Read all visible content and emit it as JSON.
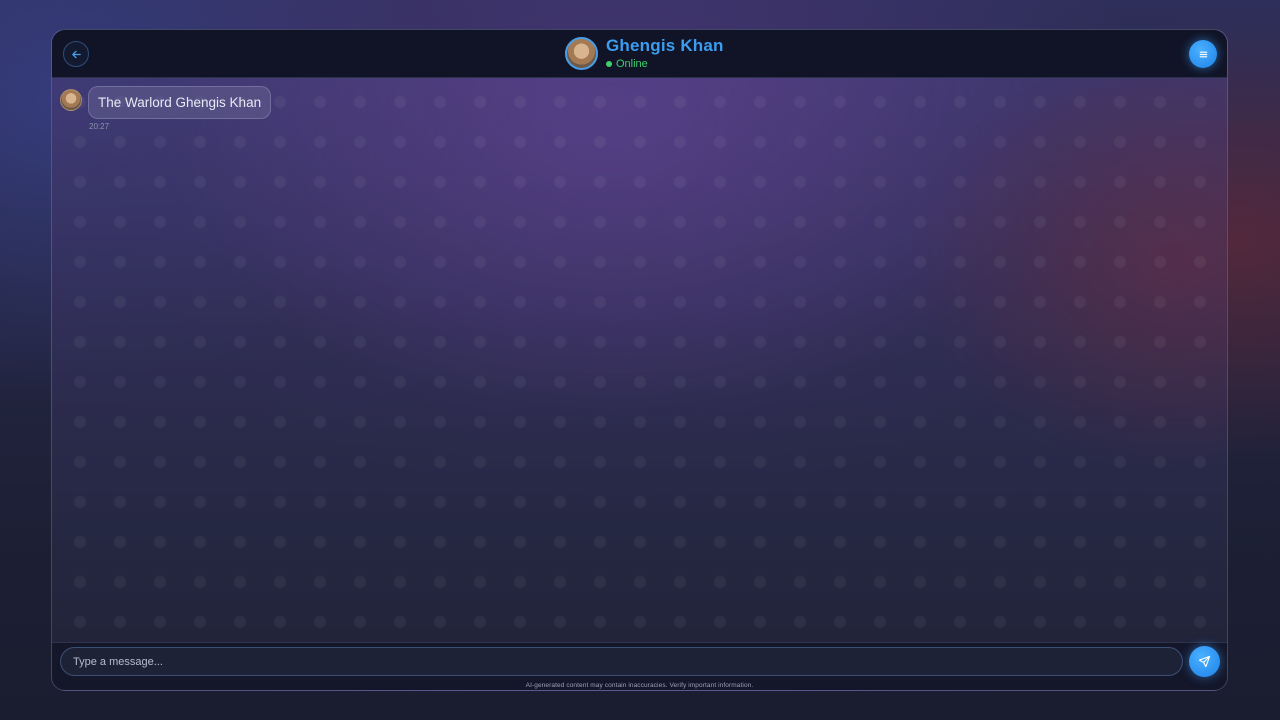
{
  "header": {
    "back_icon": "arrow-left-icon",
    "contact_name": "Ghengis Khan",
    "status": "Online",
    "menu_icon": "menu-icon"
  },
  "messages": [
    {
      "sender": "bot",
      "text": "The Warlord Ghengis Khan",
      "time": "20:27"
    }
  ],
  "composer": {
    "placeholder": "Type a message...",
    "send_icon": "send-icon"
  },
  "footer": {
    "disclaimer": "AI-generated content may contain inaccuracies. Verify important information."
  },
  "colors": {
    "accent": "#3b9cf0",
    "online": "#3ecf6e",
    "header_bg": "#111426"
  }
}
